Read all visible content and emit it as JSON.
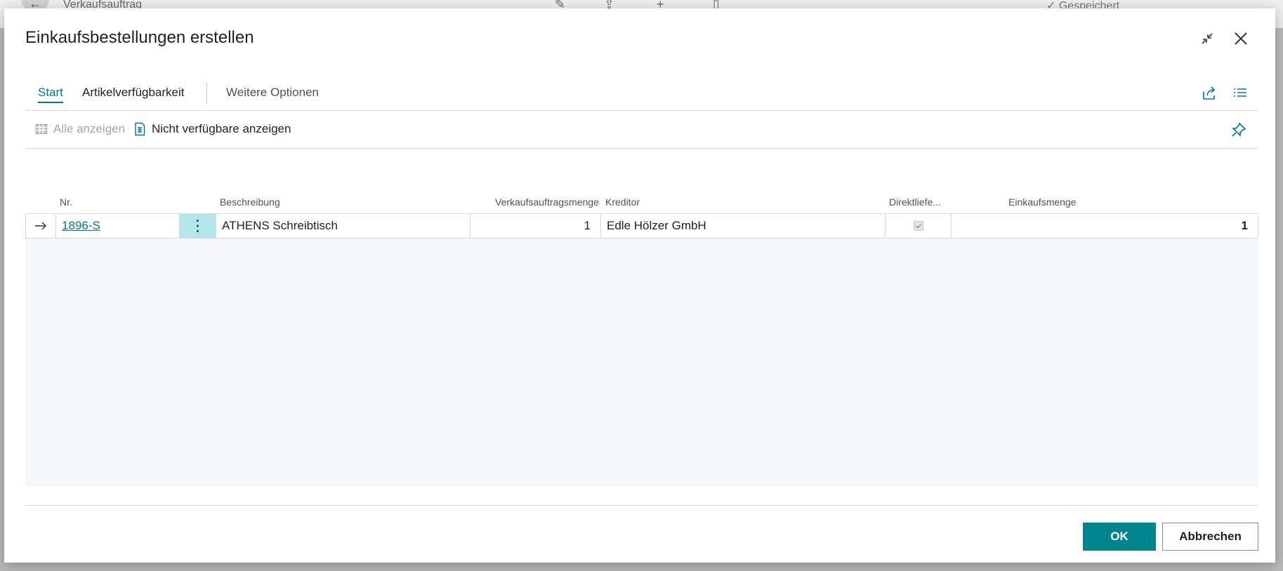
{
  "background": {
    "page_title": "Verkaufsauftrag",
    "saved_label": "Gespeichert"
  },
  "dialog": {
    "title": "Einkaufsbestellungen erstellen"
  },
  "tabs": [
    {
      "label": "Start",
      "active": true
    },
    {
      "label": "Artikelverfügbarkeit",
      "active": false
    },
    {
      "label": "Weitere Optionen",
      "active": false
    }
  ],
  "toolbar": {
    "show_all_label": "Alle anzeigen",
    "show_unavailable_label": "Nicht verfügbare anzeigen"
  },
  "grid": {
    "columns": {
      "nr": "Nr.",
      "description": "Beschreibung",
      "sales_qty": "Verkaufsauftragsmenge",
      "vendor": "Kreditor",
      "drop_ship": "Direktliefe...",
      "purchase_qty": "Einkaufsmenge"
    },
    "rows": [
      {
        "nr": "1896-S",
        "description": "ATHENS Schreibtisch",
        "sales_qty": "1",
        "vendor": "Edle Hölzer GmbH",
        "drop_ship_checked": true,
        "purchase_qty": "1"
      }
    ]
  },
  "footer": {
    "ok_label": "OK",
    "cancel_label": "Abbrechen"
  },
  "colors": {
    "accent": "#00788a",
    "primary_button": "#00858f",
    "selected_cell": "#b3e6ea"
  }
}
